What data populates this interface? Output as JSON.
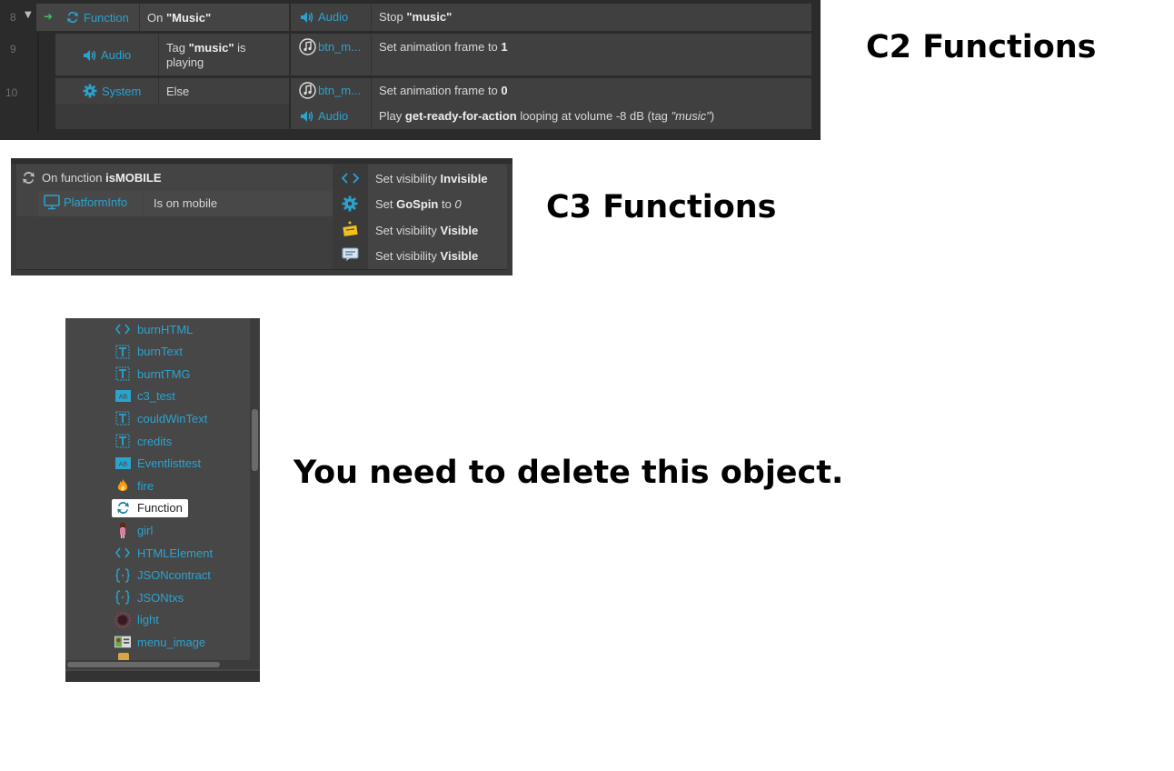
{
  "labels": {
    "c2_label": "C2 Functions",
    "c3_label": "C3 Functions",
    "delete_note": "You need to delete this object."
  },
  "c2": {
    "rows": [
      {
        "num": "8",
        "object": "Function",
        "condition_prefix": "On ",
        "condition_bold": "\"Music\"",
        "action_object": "Audio",
        "action_prefix": "Stop ",
        "action_bold": "\"music\""
      },
      {
        "num": "9",
        "object": "Audio",
        "condition_prefix": "Tag ",
        "condition_bold": "\"music\"",
        "condition_suffix": " is",
        "condition_line2": "playing",
        "action_object": "btn_m...",
        "action_prefix": "Set animation frame to ",
        "action_bold": "1"
      },
      {
        "num": "10",
        "object": "System",
        "condition_text": "Else",
        "action_object": "btn_m...",
        "action_prefix": "Set animation frame to ",
        "action_bold": "0",
        "action2_object": "Audio",
        "action2_prefix": "Play ",
        "action2_bold": "get-ready-for-action",
        "action2_mid": " looping at volume -8 dB (tag ",
        "action2_italic": "\"music\"",
        "action2_end": ")"
      }
    ]
  },
  "c3": {
    "event_prefix": "On function ",
    "event_bold": "isMOBILE",
    "sub_object": "PlatformInfo",
    "sub_condition": "Is on mobile",
    "actions": [
      {
        "prefix": "Set visibility ",
        "bold": "Invisible",
        "icon": "html-tag-icon"
      },
      {
        "prefix": "Set ",
        "bold": "GoSpin",
        "mid": " to ",
        "italic": "0",
        "icon": "gear-icon"
      },
      {
        "prefix": "Set visibility ",
        "bold": "Visible",
        "icon": "sprite-icon"
      },
      {
        "prefix": "Set visibility ",
        "bold": "Visible",
        "icon": "text-box-icon"
      }
    ]
  },
  "tree": {
    "items": [
      {
        "label": "burnHTML",
        "icon": "html-element-icon"
      },
      {
        "label": "burnText",
        "icon": "text-icon"
      },
      {
        "label": "burntTMG",
        "icon": "text-icon"
      },
      {
        "label": "c3_test",
        "icon": "sprite-font-icon"
      },
      {
        "label": "couldWinText",
        "icon": "text-icon"
      },
      {
        "label": "credits",
        "icon": "text-icon"
      },
      {
        "label": "Eventlisttest",
        "icon": "sprite-font-icon"
      },
      {
        "label": "fire",
        "icon": "fire-icon"
      },
      {
        "label": "Function",
        "icon": "function-icon",
        "selected": true
      },
      {
        "label": "girl",
        "icon": "girl-sprite-icon"
      },
      {
        "label": "HTMLElement",
        "icon": "html-element-icon"
      },
      {
        "label": "JSONcontract",
        "icon": "json-icon"
      },
      {
        "label": "JSONtxs",
        "icon": "json-icon"
      },
      {
        "label": "light",
        "icon": "light-icon"
      },
      {
        "label": "menu_image",
        "icon": "image-icon"
      }
    ]
  },
  "colors": {
    "teal": "#2aa3cf",
    "dark_bg": "#2b2b2b",
    "cell_bg": "#404040",
    "panel_bg": "#3a3a3a",
    "tree_bg": "#474747"
  }
}
